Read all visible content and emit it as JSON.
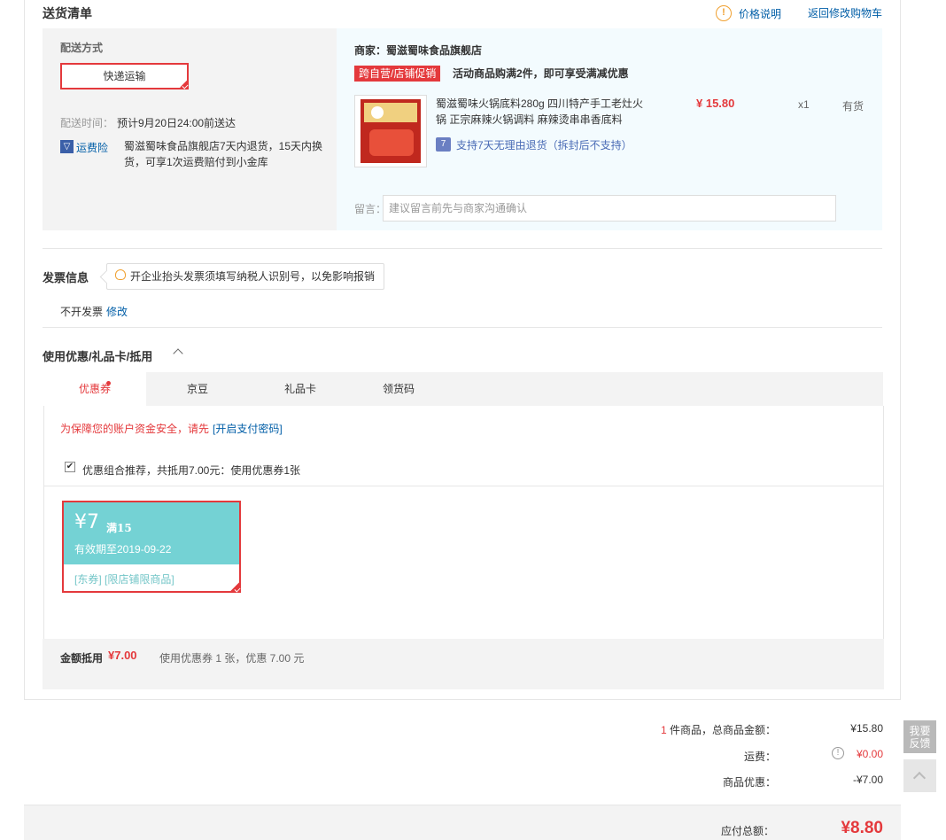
{
  "shipping_list": {
    "title": "送货清单",
    "price_info": "价格说明",
    "back_to_cart": "返回修改购物车"
  },
  "delivery": {
    "method_label": "配送方式",
    "method_selected": "快递运输",
    "time_label": "配送时间：",
    "time_value": "预计9月20日24:00前送达",
    "insurance_label": "运费险",
    "insurance_desc": "蜀滋蜀味食品旗舰店7天内退货，15天内换货，可享1次运费赔付到小金库"
  },
  "merchant": {
    "label": "商家：蜀滋蜀味食品旗舰店",
    "promo_tag": "跨自营/店铺促销",
    "promo_text": "活动商品购满2件，即可享受满减优惠",
    "product_name": "蜀滋蜀味火锅底料280g 四川特产手工老灶火锅 正宗麻辣火锅调料 麻辣烫串串香底料",
    "price": "¥ 15.80",
    "qty": "x1",
    "stock": "有货",
    "return_policy": "支持7天无理由退货（拆封后不支持）",
    "note_label": "留言：",
    "note_placeholder": "建议留言前先与商家沟通确认"
  },
  "invoice": {
    "title": "发票信息",
    "tip": "开企业抬头发票须填写纳税人识别号，以免影响报销",
    "status": "不开发票",
    "edit": "修改"
  },
  "discount": {
    "title": "使用优惠/礼品卡/抵用",
    "tabs": [
      "优惠券",
      "京豆",
      "礼品卡",
      "领货码"
    ],
    "security_text": "为保障您的账户资金安全，请先",
    "security_link": "[开启支付密码]",
    "combo_text": "优惠组合推荐，共抵用7.00元：使用优惠券1张",
    "coupon_amount": "¥7",
    "coupon_condition": "满15",
    "coupon_expiry": "有效期至2019-09-22",
    "coupon_tags": "[东券] [限店铺限商品]",
    "sum_label": "金额抵用",
    "sum_value": "¥7.00",
    "sum_desc": "使用优惠券 1 张，优惠 7.00 元"
  },
  "summary": {
    "item_count": "1",
    "total_label": "件商品，总商品金额：",
    "total_value": "¥15.80",
    "freight_label": "运费：",
    "freight_value": "¥0.00",
    "discount_label": "商品优惠：",
    "discount_value": "-¥7.00",
    "payable_label": "应付总额：",
    "payable_value": "¥8.80"
  },
  "side": {
    "feedback": "我要反馈"
  },
  "colors": {
    "accent_red": "#e4393c",
    "link_blue": "#005ea7",
    "coupon_teal": "#74d2d4"
  }
}
